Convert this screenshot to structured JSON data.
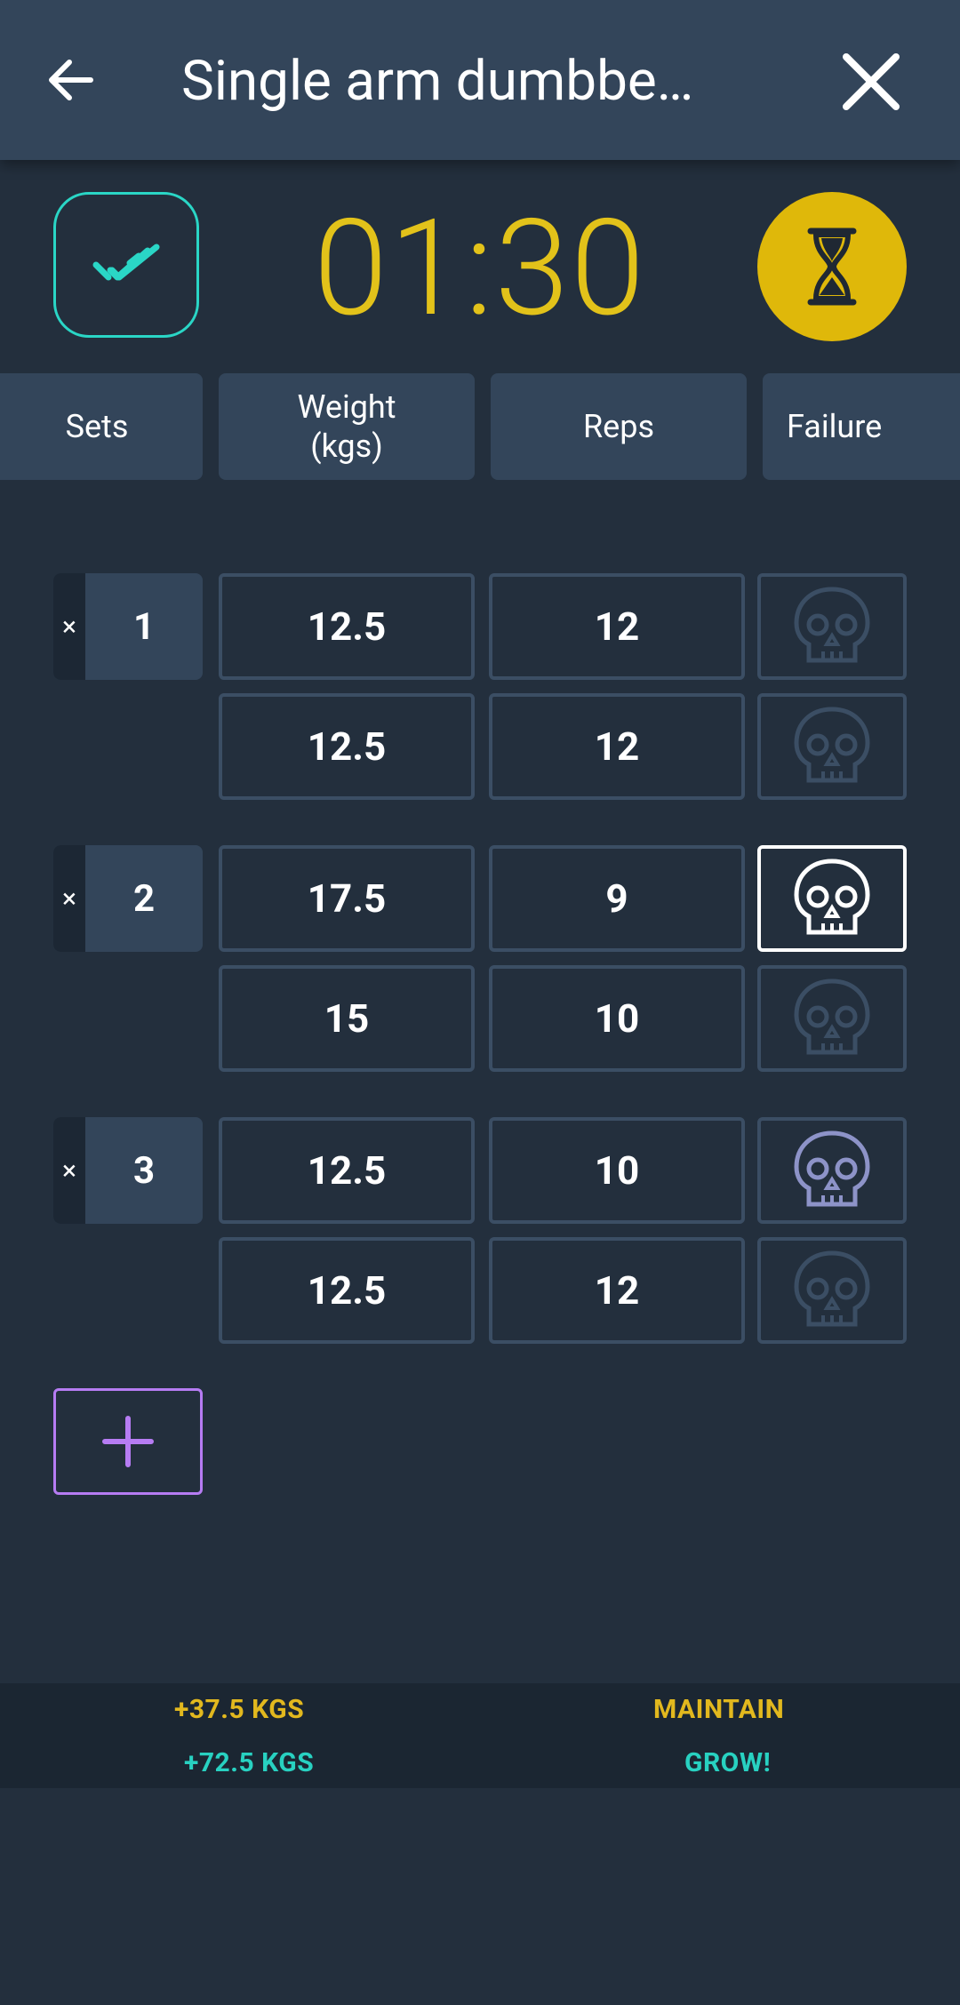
{
  "header": {
    "title": "Single arm dumbbe…",
    "back_icon": "arrow-left-icon",
    "close_icon": "close-icon"
  },
  "timer": {
    "value": "01:30",
    "done_icon": "double-check-icon",
    "hourglass_icon": "hourglass-icon"
  },
  "columns": {
    "sets": "Sets",
    "weight_line1": "Weight",
    "weight_line2": "(kgs)",
    "reps": "Reps",
    "failure": "Failure"
  },
  "sets": [
    {
      "number": "1",
      "delete": "×",
      "rows": [
        {
          "weight": "12.5",
          "reps": "12",
          "failure": "off"
        },
        {
          "weight": "12.5",
          "reps": "12",
          "failure": "off"
        }
      ]
    },
    {
      "number": "2",
      "delete": "×",
      "rows": [
        {
          "weight": "17.5",
          "reps": "9",
          "failure": "on"
        },
        {
          "weight": "15",
          "reps": "10",
          "failure": "off"
        }
      ]
    },
    {
      "number": "3",
      "delete": "×",
      "rows": [
        {
          "weight": "12.5",
          "reps": "10",
          "failure": "partial"
        },
        {
          "weight": "12.5",
          "reps": "12",
          "failure": "off"
        }
      ]
    }
  ],
  "summary": {
    "row1_left": "+37.5 KGS",
    "row1_right": "MAINTAIN",
    "row2_left": "+72.5 KGS",
    "row2_right": "GROW!"
  },
  "colors": {
    "background": "#232f3d",
    "bar": "#33455a",
    "timer": "#e2c21a",
    "accent_teal": "#28d1c1",
    "add_purple": "#b67cf3"
  }
}
